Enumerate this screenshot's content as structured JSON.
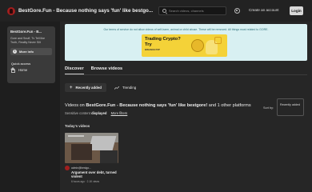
{
  "header": {
    "channel_title": "BestGore.Fun - Because nothing says 'fun' like bestgo...",
    "search_placeholder": "Search videos, channels",
    "create_account": "Create an account",
    "login": "Login"
  },
  "sidebar": {
    "card_title": "BestGore.Fun - B...",
    "card_desc": "Gore and Snuff, Tv Tell like Truth, Reality Never Silt",
    "more_info": "More info",
    "quick_access": "Quick access",
    "home": "Home"
  },
  "banner": {
    "notice": "Our terms of service do not allow videos of self-harm, animal or child abuse. These will be removed. All things must related to GORE.",
    "ad_title_1": "Trading Crypto?",
    "ad_title_2": "Try",
    "ad_brand": "BINANCE P2P"
  },
  "tabs": [
    "Discover",
    "Browse videos"
  ],
  "filters": {
    "recently_added": "Recently added",
    "trending": "Trending"
  },
  "listing": {
    "heading_prefix": "Videos on ",
    "heading_channel": "BestGore.Fun - Because nothing says 'fun' like bestgore!",
    "heading_suffix": " and 1 other platforms",
    "sensitive_label": "Sensitive content ",
    "sensitive_value": "displayed",
    "more_filters": "More filters",
    "sort_label": "Sort by:",
    "sort_value": "Recently added",
    "today": "Today's videos"
  },
  "videos": [
    {
      "channel": "admin@bestgo...",
      "title": "Argument over debt, turned violent",
      "stats": "6 hours ago · 2.1K views"
    }
  ],
  "colors": {
    "logo": "#a11e1e",
    "banner_bg": "#d8f0f2",
    "banner_text": "#2b6f79",
    "ad_yellow": "#f4d238"
  }
}
